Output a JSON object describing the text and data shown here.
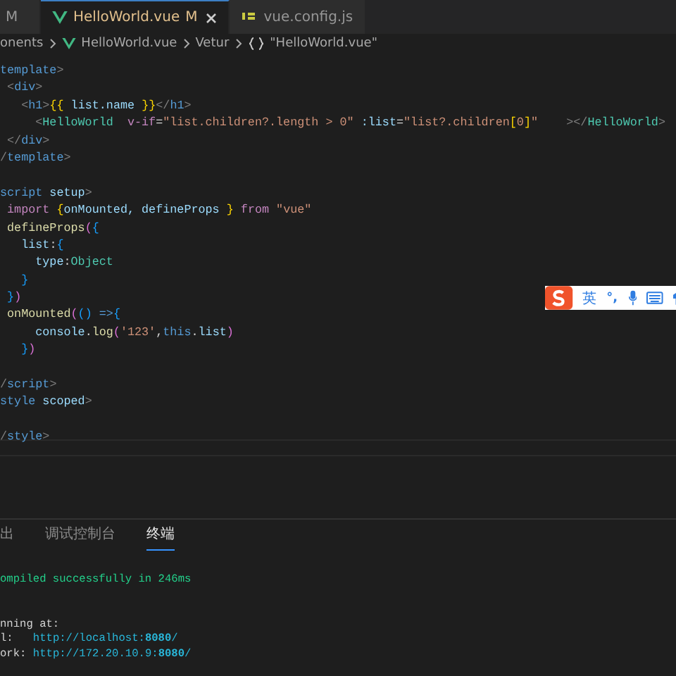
{
  "tabs": [
    {
      "badge": "M",
      "selected": false
    },
    {
      "kind": "vue",
      "label": "HelloWorld.vue",
      "badge": "M",
      "selected": true
    },
    {
      "kind": "js",
      "label": "vue.config.js",
      "selected": false
    }
  ],
  "breadcrumb": [
    {
      "text": "onents"
    },
    {
      "kind": "vue",
      "text": "HelloWorld.vue"
    },
    {
      "text": "Vetur"
    },
    {
      "kind": "symbol",
      "text": "\"HelloWorld.vue\""
    }
  ],
  "code": [
    {
      "tokens": [
        {
          "kind": "tag",
          "text": "template"
        },
        {
          "kind": "punct",
          "text": ">"
        }
      ]
    },
    {
      "tokens": [
        {
          "kind": "punct",
          "text": " <"
        },
        {
          "kind": "tag",
          "text": "div"
        },
        {
          "kind": "punct",
          "text": ">"
        }
      ]
    },
    {
      "tokens": [
        {
          "kind": "punct",
          "text": "   <"
        },
        {
          "kind": "tag",
          "text": "h1"
        },
        {
          "kind": "punct",
          "text": ">"
        },
        {
          "kind": "brace",
          "text": "{{"
        },
        {
          "kind": "var",
          "text": " list.name "
        },
        {
          "kind": "brace",
          "text": "}}"
        },
        {
          "kind": "punct",
          "text": "</"
        },
        {
          "kind": "tag",
          "text": "h1"
        },
        {
          "kind": "punct",
          "text": ">"
        }
      ]
    },
    {
      "tokens": [
        {
          "kind": "punct",
          "text": "     <"
        },
        {
          "kind": "comp",
          "text": "HelloWorld"
        },
        {
          "kind": "directive",
          "text": "  v-if"
        },
        {
          "kind": "plain",
          "text": "="
        },
        {
          "kind": "string",
          "text": "\"list.children?.length > 0\""
        },
        {
          "kind": "var",
          "text": " :list"
        },
        {
          "kind": "plain",
          "text": "="
        },
        {
          "kind": "string",
          "text": "\"list?.children"
        },
        {
          "kind": "brace",
          "text": "["
        },
        {
          "kind": "string",
          "text": "0"
        },
        {
          "kind": "brace",
          "text": "]"
        },
        {
          "kind": "string",
          "text": "\""
        },
        {
          "kind": "punct",
          "text": "    ></"
        },
        {
          "kind": "comp",
          "text": "HelloWorld"
        },
        {
          "kind": "punct",
          "text": ">"
        }
      ]
    },
    {
      "tokens": [
        {
          "kind": "punct",
          "text": " </"
        },
        {
          "kind": "tag",
          "text": "div"
        },
        {
          "kind": "punct",
          "text": ">"
        }
      ]
    },
    {
      "tokens": [
        {
          "kind": "punct",
          "text": "/"
        },
        {
          "kind": "tag",
          "text": "template"
        },
        {
          "kind": "punct",
          "text": ">"
        }
      ]
    },
    {
      "gap_before": true,
      "tokens": [
        {
          "kind": "tag",
          "text": "script"
        },
        {
          "kind": "var",
          "text": " setup"
        },
        {
          "kind": "punct",
          "text": ">"
        }
      ]
    },
    {
      "tokens": [
        {
          "kind": "keyword",
          "text": " import"
        },
        {
          "kind": "brace",
          "text": " {"
        },
        {
          "kind": "var",
          "text": "onMounted, defineProps "
        },
        {
          "kind": "brace",
          "text": "}"
        },
        {
          "kind": "keyword",
          "text": " from"
        },
        {
          "kind": "string",
          "text": " \"vue\""
        }
      ]
    },
    {
      "tokens": [
        {
          "kind": "func",
          "text": " defineProps"
        },
        {
          "kind": "paren",
          "text": "("
        },
        {
          "kind": "bracket",
          "text": "{"
        }
      ]
    },
    {
      "tokens": [
        {
          "kind": "var",
          "text": "   list"
        },
        {
          "kind": "plain",
          "text": ":"
        },
        {
          "kind": "bracket",
          "text": "{"
        }
      ]
    },
    {
      "tokens": [
        {
          "kind": "var",
          "text": "     type"
        },
        {
          "kind": "plain",
          "text": ":"
        },
        {
          "kind": "type",
          "text": "Object"
        }
      ]
    },
    {
      "tokens": [
        {
          "kind": "bracket",
          "text": "   }"
        }
      ]
    },
    {
      "tokens": [
        {
          "kind": "bracket",
          "text": " }"
        },
        {
          "kind": "paren",
          "text": ")"
        }
      ]
    },
    {
      "tokens": [
        {
          "kind": "func",
          "text": " onMounted"
        },
        {
          "kind": "paren",
          "text": "("
        },
        {
          "kind": "bracket",
          "text": "()"
        },
        {
          "kind": "tag",
          "text": " =>"
        },
        {
          "kind": "bracket",
          "text": "{"
        }
      ]
    },
    {
      "tokens": [
        {
          "kind": "var",
          "text": "     console"
        },
        {
          "kind": "plain",
          "text": "."
        },
        {
          "kind": "func",
          "text": "log"
        },
        {
          "kind": "paren",
          "text": "("
        },
        {
          "kind": "string",
          "text": "'123'"
        },
        {
          "kind": "plain",
          "text": ","
        },
        {
          "kind": "tag",
          "text": "this"
        },
        {
          "kind": "plain",
          "text": "."
        },
        {
          "kind": "var",
          "text": "list"
        },
        {
          "kind": "paren",
          "text": ")"
        }
      ]
    },
    {
      "tokens": [
        {
          "kind": "bracket",
          "text": "   }"
        },
        {
          "kind": "paren",
          "text": ")"
        }
      ]
    },
    {
      "gap_before": true,
      "tokens": [
        {
          "kind": "punct",
          "text": "/"
        },
        {
          "kind": "tag",
          "text": "script"
        },
        {
          "kind": "punct",
          "text": ">"
        }
      ]
    },
    {
      "tokens": [
        {
          "kind": "tag",
          "text": "style"
        },
        {
          "kind": "var",
          "text": " scoped"
        },
        {
          "kind": "punct",
          "text": ">"
        }
      ]
    },
    {
      "gap_before": true,
      "tokens": [
        {
          "kind": "punct",
          "text": "/"
        },
        {
          "kind": "tag",
          "text": "style"
        },
        {
          "kind": "punct",
          "text": ">"
        }
      ]
    }
  ],
  "ime_bar": {
    "mode": "英",
    "punctuation": "°,"
  },
  "panel_tabs": [
    {
      "label": "出",
      "selected": false
    },
    {
      "label": "调试控制台",
      "selected": false
    },
    {
      "label": "终端",
      "selected": true
    }
  ],
  "terminal": [
    {
      "tokens": [
        {
          "kind": "success",
          "text": "ompiled successfully in 246ms"
        }
      ]
    },
    {
      "tokens": [
        {
          "kind": "plain",
          "text": "nning at:"
        }
      ]
    },
    {
      "tokens": [
        {
          "kind": "plain",
          "text": "l:   "
        },
        {
          "kind": "link",
          "text": "http://localhost:"
        },
        {
          "kind": "port",
          "text": "8080"
        },
        {
          "kind": "link",
          "text": "/"
        }
      ]
    },
    {
      "tokens": [
        {
          "kind": "plain",
          "text": "ork: "
        },
        {
          "kind": "link",
          "text": "http://172.20.10.9:"
        },
        {
          "kind": "port",
          "text": "8080"
        },
        {
          "kind": "link",
          "text": "/"
        }
      ]
    }
  ]
}
